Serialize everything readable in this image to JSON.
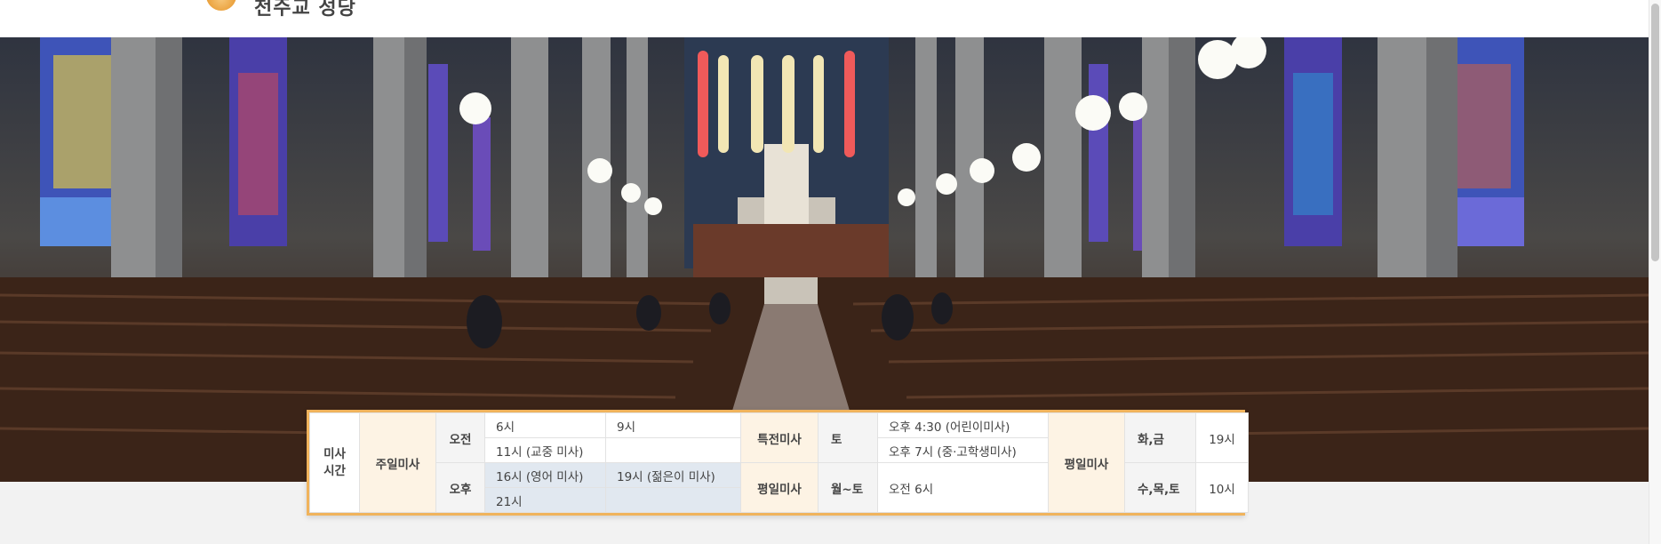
{
  "header": {
    "logo_text": "천주교 성당"
  },
  "mass_schedule": {
    "title": "미사\n시간",
    "sunday": {
      "label": "주일미사",
      "am_label": "오전",
      "pm_label": "오후",
      "am_times": [
        "6시",
        "9시",
        "11시 (교중 미사)",
        ""
      ],
      "pm_times": [
        "16시 (영어 미사)",
        "19시 (젊은이 미사)",
        "21시",
        ""
      ]
    },
    "special": {
      "label": "특전미사",
      "day": "토",
      "times": [
        "오후 4:30 (어린이미사)",
        "오후 7시 (중·고학생미사)"
      ]
    },
    "weekday": {
      "label": "평일미사",
      "day": "월~토",
      "time": "오전 6시"
    },
    "weekday_right": {
      "label": "평일미사",
      "rows": [
        {
          "days": "화,금",
          "time": "19시"
        },
        {
          "days": "수,목,토",
          "time": "10시"
        }
      ]
    }
  },
  "colors": {
    "accent_border": "#f0b35c",
    "cream": "#fdf3e4",
    "blue_cell": "#e1e8f0"
  }
}
